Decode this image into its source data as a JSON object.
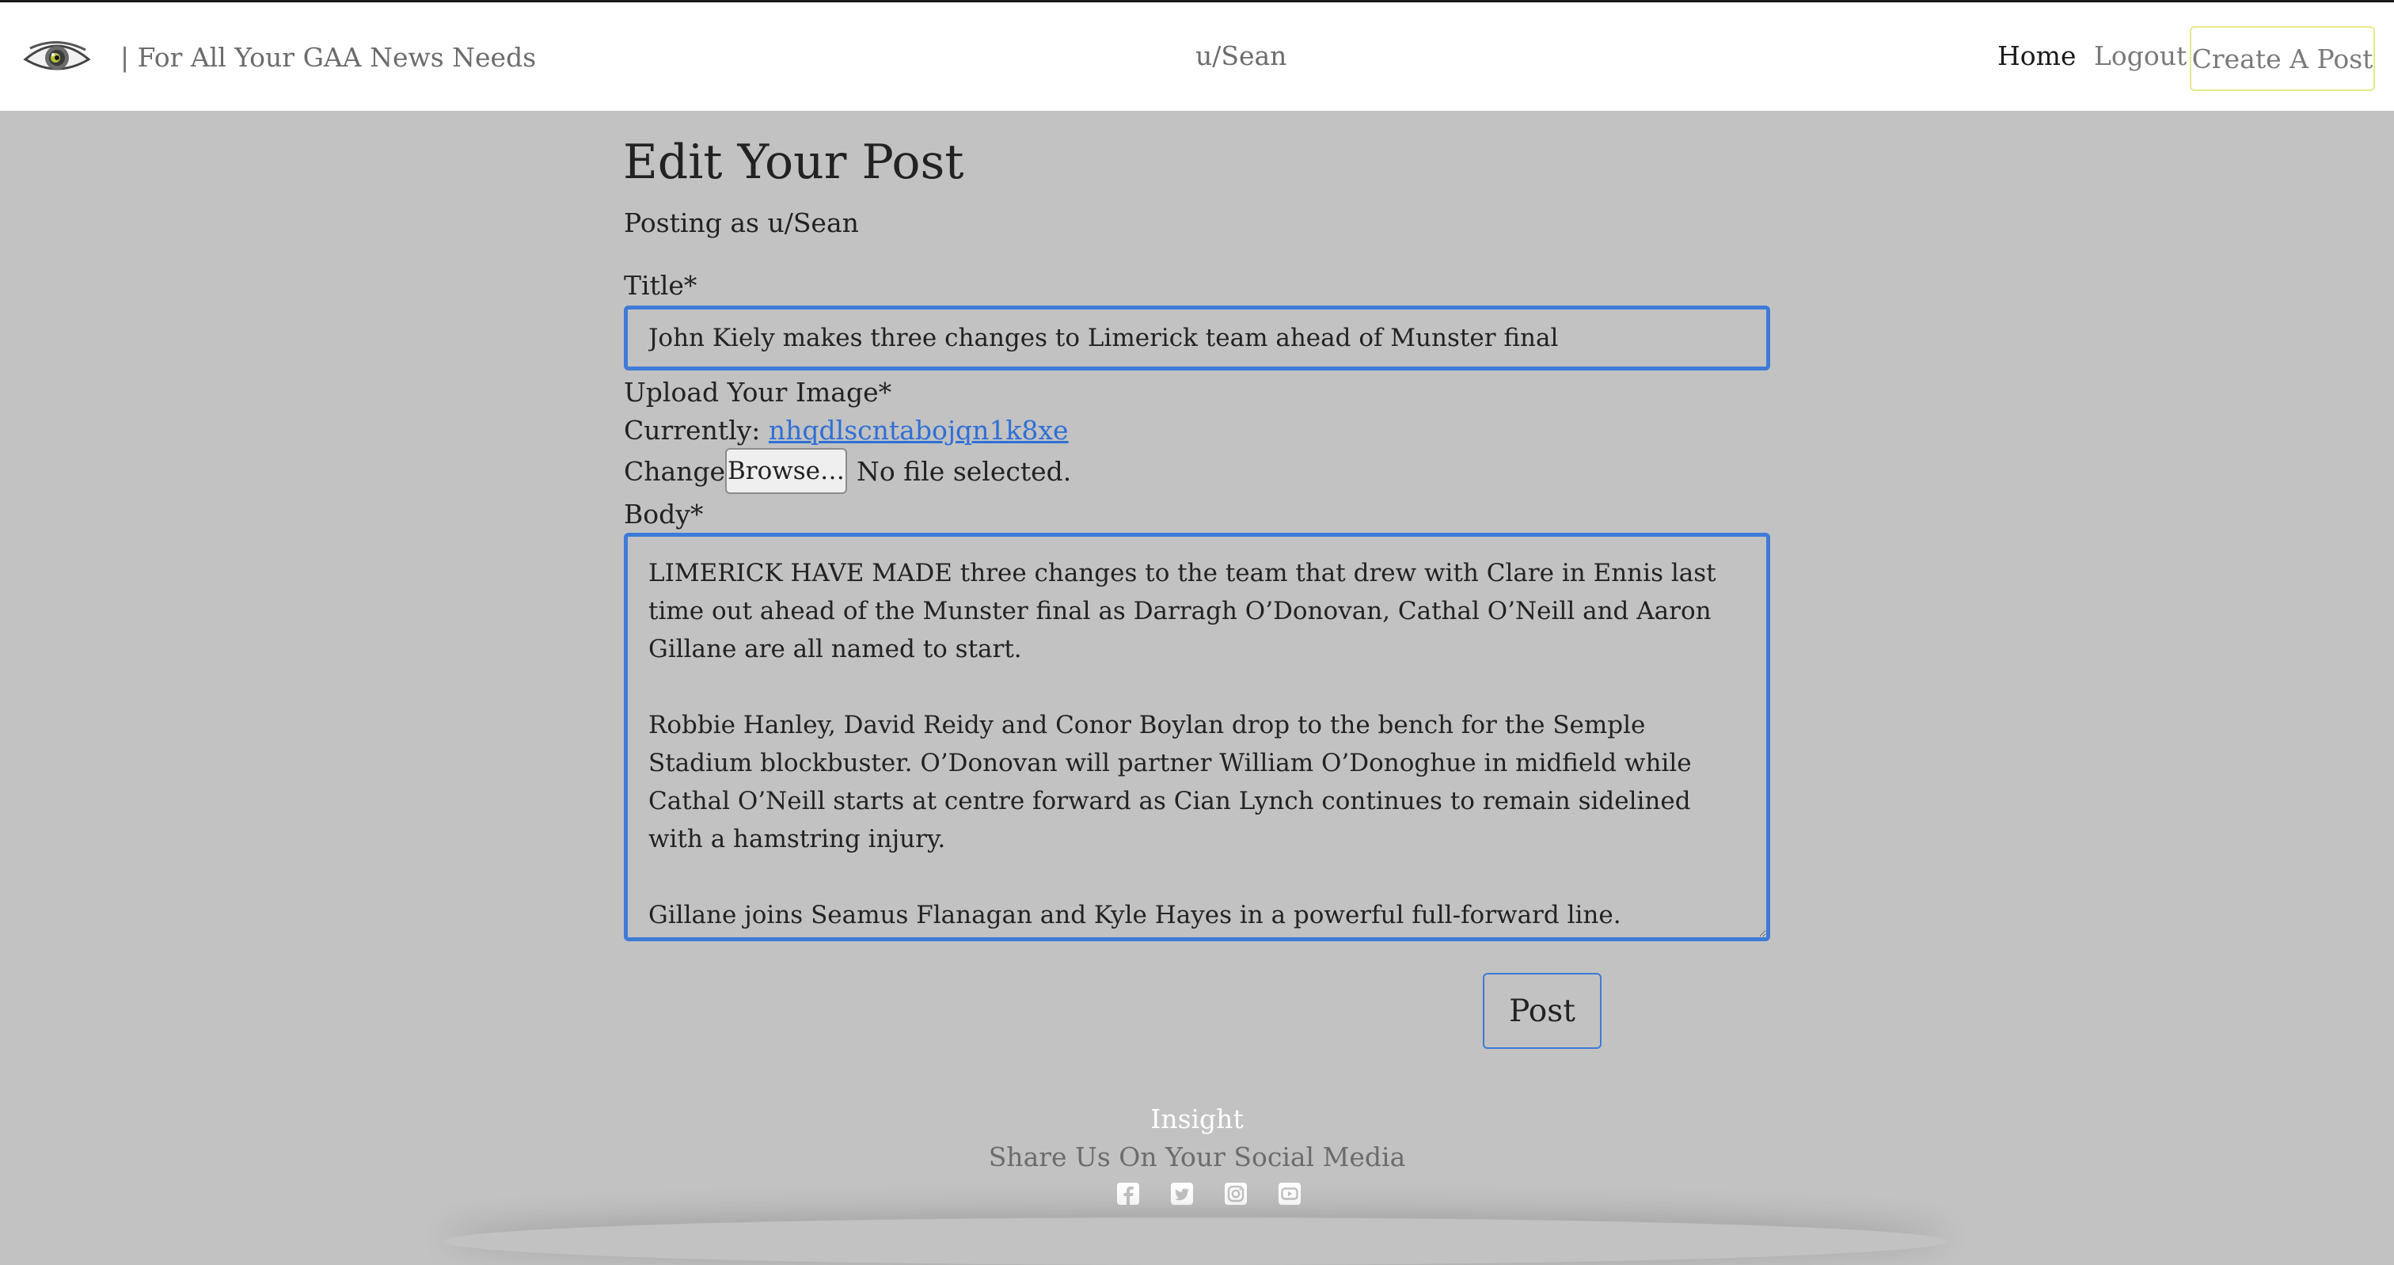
{
  "navbar": {
    "tagline": "| For All Your GAA News Needs",
    "username": "u/Sean",
    "links": {
      "home": "Home",
      "logout": "Logout",
      "create_post": "Create A Post"
    }
  },
  "form": {
    "heading": "Edit Your Post",
    "posting_as": "Posting as u/Sean",
    "title_label": "Title*",
    "title_value": "John Kiely makes three changes to Limerick team ahead of Munster final",
    "image_label": "Upload Your Image*",
    "currently_label": "Currently:",
    "current_image": "nhqdlscntabojqn1k8xe",
    "change_label": "Change:",
    "browse_label": "Browse…",
    "no_file_text": "No file selected.",
    "body_label": "Body*",
    "body_value": "LIMERICK HAVE MADE three changes to the team that drew with Clare in Ennis last time out ahead of the Munster final as Darragh O’Donovan, Cathal O’Neill and Aaron Gillane are all named to start.\n\nRobbie Hanley, David Reidy and Conor Boylan drop to the bench for the Semple Stadium blockbuster. O’Donovan will partner William O’Donoghue in midfield while Cathal O’Neill starts at centre forward as Cian Lynch continues to remain sidelined with a hamstring injury.\n\nGillane joins Seamus Flanagan and Kyle Hayes in a powerful full-forward line.",
    "submit_label": "Post"
  },
  "footer": {
    "brand": "Insight",
    "share_text": "Share Us On Your Social Media",
    "social_icons": [
      "facebook-icon",
      "twitter-icon",
      "instagram-icon",
      "youtube-icon"
    ]
  },
  "colors": {
    "page_background": "#c2c2c2",
    "navbar_background": "#ffffff",
    "input_border": "#3e7bd8",
    "link": "#2f6fd6",
    "create_post_border": "#e6e88a"
  }
}
